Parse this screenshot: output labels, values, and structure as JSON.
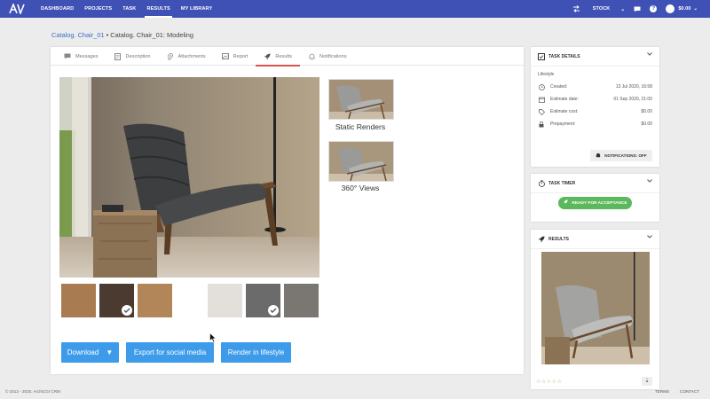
{
  "nav": {
    "logo_text": "AV",
    "items": [
      "DASHBOARD",
      "PROJECTS",
      "TASK",
      "RESULTS",
      "MY LIBRARY"
    ],
    "active_index": 3,
    "stock_label": "STOCK",
    "balance": "$0.00"
  },
  "breadcrumb": {
    "link": "Catalog. Chair_01",
    "separator": " • ",
    "current": "Catalog. Chair_01: Modeling"
  },
  "tabs": [
    {
      "label": "Messages",
      "icon": "chat-icon"
    },
    {
      "label": "Description",
      "icon": "document-icon"
    },
    {
      "label": "Attachments",
      "icon": "paperclip-icon"
    },
    {
      "label": "Report",
      "icon": "image-icon"
    },
    {
      "label": "Results",
      "icon": "rocket-icon"
    },
    {
      "label": "Notifications",
      "icon": "bell-icon"
    }
  ],
  "active_tab": 4,
  "thumbnails": {
    "static_label": "Static Renders",
    "views_label": "360° Views"
  },
  "swatches": [
    {
      "color": "#a87c50",
      "checked": false
    },
    {
      "color": "#4a3a30",
      "checked": true
    },
    {
      "color": "#b3865a",
      "checked": false
    },
    {
      "color": "#e3e0dc",
      "checked": false
    },
    {
      "color": "#6b6b6b",
      "checked": true
    },
    {
      "color": "#7a7772",
      "checked": false
    }
  ],
  "buttons": {
    "download": "Download",
    "export": "Export for social media",
    "render": "Render in lifestyle"
  },
  "task_details": {
    "title": "TASK DETAILS",
    "subtitle": "Lifestyle",
    "rows": [
      {
        "label": "Created:",
        "value": "13 Jul 2020, 16:58",
        "icon": "clock-icon"
      },
      {
        "label": "Estimate date:",
        "value": "01 Sep 2020, 21:00",
        "icon": "calendar-icon"
      },
      {
        "label": "Estimate cost:",
        "value": "$0.00",
        "icon": "tag-icon"
      },
      {
        "label": "Prepayment:",
        "value": "$0.00",
        "icon": "lock-icon"
      }
    ],
    "notifications_btn": "NOTIFICATIONS: OFF"
  },
  "task_timer": {
    "title": "TASK TIMER",
    "ready_btn": "READY FOR ACCEPTANCE"
  },
  "results_card": {
    "title": "RESULTS",
    "stars": "☆☆☆☆☆"
  },
  "footer": {
    "copyright": "© 2012 - 2020. ArchiCGI CRM",
    "links": [
      "TERMS",
      "CONTACT"
    ]
  },
  "colors": {
    "nav_bg": "#3f51b5",
    "button_blue": "#3d9be9",
    "ready_green": "#5cb85c",
    "active_tab": "#d9534f"
  }
}
